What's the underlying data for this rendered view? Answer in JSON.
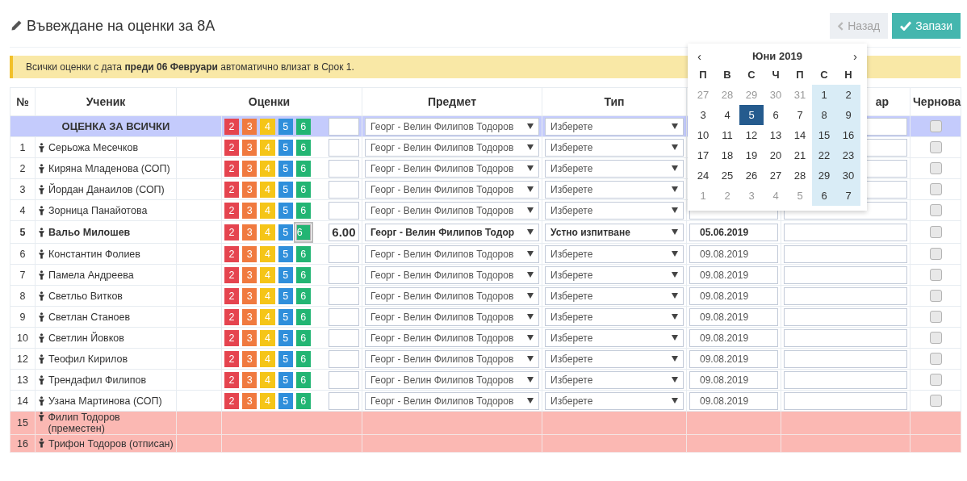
{
  "title": "Въвеждане на оценки за 8А",
  "buttons": [
    {
      "kind": "back",
      "label": "Назад",
      "disabled": true
    },
    {
      "kind": "save",
      "label": "Запази",
      "disabled": false
    }
  ],
  "alert": "Всички оценки с дата **преди 06 Февруари** автоматично влизат в Срок 1.",
  "columns": [
    "№",
    "Ученик",
    "Оценки",
    "Предмет",
    "Тип",
    "ар",
    "Чернова"
  ],
  "rows": [
    {
      "kind": "all",
      "label": "ОЦЕНКА ЗА ВСИЧКИ",
      "grades": [
        {
          "label": "2",
          "color": "#e5444f",
          "selected": false
        },
        {
          "label": "3",
          "color": "#f07a3f",
          "selected": false
        },
        {
          "label": "4",
          "color": "#f5c518",
          "selected": false
        },
        {
          "label": "5",
          "color": "#2f8fdb",
          "selected": false
        },
        {
          "label": "6",
          "color": "#22b573",
          "selected": false
        }
      ],
      "subject": "Георг - Велин Филипов Тодоров",
      "type": "Изберете",
      "checked": false,
      "edited": false
    },
    {
      "kind": "student",
      "number": "1",
      "name": "Серьожа Месечков",
      "grades": [
        {
          "label": "2",
          "color": "#e5444f",
          "selected": false
        },
        {
          "label": "3",
          "color": "#f07a3f",
          "selected": false
        },
        {
          "label": "4",
          "color": "#f5c518",
          "selected": false
        },
        {
          "label": "5",
          "color": "#2f8fdb",
          "selected": false
        },
        {
          "label": "6",
          "color": "#22b573",
          "selected": false
        }
      ],
      "subject": "Георг - Велин Филипов Тодоров",
      "type": "Изберете",
      "checked": false,
      "edited": false
    },
    {
      "kind": "student",
      "number": "2",
      "name": "Киряна Младенова (СОП)",
      "grades": [
        {
          "label": "2",
          "color": "#e5444f",
          "selected": false
        },
        {
          "label": "3",
          "color": "#f07a3f",
          "selected": false
        },
        {
          "label": "4",
          "color": "#f5c518",
          "selected": false
        },
        {
          "label": "5",
          "color": "#2f8fdb",
          "selected": false
        },
        {
          "label": "6",
          "color": "#22b573",
          "selected": false
        }
      ],
      "subject": "Георг - Велин Филипов Тодоров",
      "type": "Изберете",
      "checked": false,
      "edited": false
    },
    {
      "kind": "student",
      "number": "3",
      "name": "Йордан Данаилов (СОП)",
      "grades": [
        {
          "label": "2",
          "color": "#e5444f",
          "selected": false
        },
        {
          "label": "3",
          "color": "#f07a3f",
          "selected": false
        },
        {
          "label": "4",
          "color": "#f5c518",
          "selected": false
        },
        {
          "label": "5",
          "color": "#2f8fdb",
          "selected": false
        },
        {
          "label": "6",
          "color": "#22b573",
          "selected": false
        }
      ],
      "subject": "Георг - Велин Филипов Тодоров",
      "type": "Изберете",
      "checked": false,
      "edited": false
    },
    {
      "kind": "student",
      "number": "4",
      "name": "Зорница Панайотова",
      "grades": [
        {
          "label": "2",
          "color": "#e5444f",
          "selected": false
        },
        {
          "label": "3",
          "color": "#f07a3f",
          "selected": false
        },
        {
          "label": "4",
          "color": "#f5c518",
          "selected": false
        },
        {
          "label": "5",
          "color": "#2f8fdb",
          "selected": false
        },
        {
          "label": "6",
          "color": "#22b573",
          "selected": false
        }
      ],
      "subject": "Георг - Велин Филипов Тодоров",
      "type": "Изберете",
      "checked": false,
      "edited": false
    },
    {
      "kind": "student",
      "number": "5",
      "name": "Вальо Милошев",
      "grades": [
        {
          "label": "2",
          "color": "#e5444f",
          "selected": false
        },
        {
          "label": "3",
          "color": "#f07a3f",
          "selected": false
        },
        {
          "label": "4",
          "color": "#f5c518",
          "selected": false
        },
        {
          "label": "5",
          "color": "#2f8fdb",
          "selected": false
        },
        {
          "label": "6",
          "color": "#22b573",
          "selected": true
        }
      ],
      "value": "6.00",
      "subject": "Георг - Велин Филипов Тодор",
      "type": "Устно изпитване",
      "date": "05.06.2019",
      "checked": false,
      "edited": true
    },
    {
      "kind": "student",
      "number": "6",
      "name": "Константин Фолиев",
      "grades": [
        {
          "label": "2",
          "color": "#e5444f",
          "selected": false
        },
        {
          "label": "3",
          "color": "#f07a3f",
          "selected": false
        },
        {
          "label": "4",
          "color": "#f5c518",
          "selected": false
        },
        {
          "label": "5",
          "color": "#2f8fdb",
          "selected": false
        },
        {
          "label": "6",
          "color": "#22b573",
          "selected": false
        }
      ],
      "subject": "Георг - Велин Филипов Тодоров",
      "type": "Изберете",
      "date": "09.08.2019",
      "checked": false,
      "edited": false
    },
    {
      "kind": "student",
      "number": "7",
      "name": "Памела Андреева",
      "grades": [
        {
          "label": "2",
          "color": "#e5444f",
          "selected": false
        },
        {
          "label": "3",
          "color": "#f07a3f",
          "selected": false
        },
        {
          "label": "4",
          "color": "#f5c518",
          "selected": false
        },
        {
          "label": "5",
          "color": "#2f8fdb",
          "selected": false
        },
        {
          "label": "6",
          "color": "#22b573",
          "selected": false
        }
      ],
      "subject": "Георг - Велин Филипов Тодоров",
      "type": "Изберете",
      "date": "09.08.2019",
      "checked": false,
      "edited": false
    },
    {
      "kind": "student",
      "number": "8",
      "name": "Светльо Витков",
      "grades": [
        {
          "label": "2",
          "color": "#e5444f",
          "selected": false
        },
        {
          "label": "3",
          "color": "#f07a3f",
          "selected": false
        },
        {
          "label": "4",
          "color": "#f5c518",
          "selected": false
        },
        {
          "label": "5",
          "color": "#2f8fdb",
          "selected": false
        },
        {
          "label": "6",
          "color": "#22b573",
          "selected": false
        }
      ],
      "subject": "Георг - Велин Филипов Тодоров",
      "type": "Изберете",
      "date": "09.08.2019",
      "checked": false,
      "edited": false
    },
    {
      "kind": "student",
      "number": "9",
      "name": "Светлан Станоев",
      "grades": [
        {
          "label": "2",
          "color": "#e5444f",
          "selected": false
        },
        {
          "label": "3",
          "color": "#f07a3f",
          "selected": false
        },
        {
          "label": "4",
          "color": "#f5c518",
          "selected": false
        },
        {
          "label": "5",
          "color": "#2f8fdb",
          "selected": false
        },
        {
          "label": "6",
          "color": "#22b573",
          "selected": false
        }
      ],
      "subject": "Георг - Велин Филипов Тодоров",
      "type": "Изберете",
      "date": "09.08.2019",
      "checked": false,
      "edited": false
    },
    {
      "kind": "student",
      "number": "10",
      "name": "Светлин Йовков",
      "grades": [
        {
          "label": "2",
          "color": "#e5444f",
          "selected": false
        },
        {
          "label": "3",
          "color": "#f07a3f",
          "selected": false
        },
        {
          "label": "4",
          "color": "#f5c518",
          "selected": false
        },
        {
          "label": "5",
          "color": "#2f8fdb",
          "selected": false
        },
        {
          "label": "6",
          "color": "#22b573",
          "selected": false
        }
      ],
      "subject": "Георг - Велин Филипов Тодоров",
      "type": "Изберете",
      "date": "09.08.2019",
      "checked": false,
      "edited": false
    },
    {
      "kind": "student",
      "number": "12",
      "name": "Теофил Кирилов",
      "grades": [
        {
          "label": "2",
          "color": "#e5444f",
          "selected": false
        },
        {
          "label": "3",
          "color": "#f07a3f",
          "selected": false
        },
        {
          "label": "4",
          "color": "#f5c518",
          "selected": false
        },
        {
          "label": "5",
          "color": "#2f8fdb",
          "selected": false
        },
        {
          "label": "6",
          "color": "#22b573",
          "selected": false
        }
      ],
      "subject": "Георг - Велин Филипов Тодоров",
      "type": "Изберете",
      "date": "09.08.2019",
      "checked": false,
      "edited": false
    },
    {
      "kind": "student",
      "number": "13",
      "name": "Трендафил Филипов",
      "grades": [
        {
          "label": "2",
          "color": "#e5444f",
          "selected": false
        },
        {
          "label": "3",
          "color": "#f07a3f",
          "selected": false
        },
        {
          "label": "4",
          "color": "#f5c518",
          "selected": false
        },
        {
          "label": "5",
          "color": "#2f8fdb",
          "selected": false
        },
        {
          "label": "6",
          "color": "#22b573",
          "selected": false
        }
      ],
      "subject": "Георг - Велин Филипов Тодоров",
      "type": "Изберете",
      "date": "09.08.2019",
      "checked": false,
      "edited": false
    },
    {
      "kind": "student",
      "number": "14",
      "name": "Узана Мартинова (СОП)",
      "grades": [
        {
          "label": "2",
          "color": "#e5444f",
          "selected": false
        },
        {
          "label": "3",
          "color": "#f07a3f",
          "selected": false
        },
        {
          "label": "4",
          "color": "#f5c518",
          "selected": false
        },
        {
          "label": "5",
          "color": "#2f8fdb",
          "selected": false
        },
        {
          "label": "6",
          "color": "#22b573",
          "selected": false
        }
      ],
      "subject": "Георг - Велин Филипов Тодоров",
      "type": "Изберете",
      "date": "09.08.2019",
      "checked": false,
      "edited": false
    },
    {
      "kind": "inactive",
      "number": "15",
      "name": "Филип Тодоров (преместен)"
    },
    {
      "kind": "inactive",
      "number": "16",
      "name": "Трифон Тодоров (отписан)"
    }
  ],
  "calendar": {
    "prev": "‹",
    "title": "Юни 2019",
    "next": "›",
    "weekdays": [
      "П",
      "В",
      "С",
      "Ч",
      "П",
      "С",
      "Н"
    ],
    "weeks": [
      [
        {
          "label": "27",
          "muted": true,
          "selected": false
        },
        {
          "label": "28",
          "muted": true,
          "selected": false
        },
        {
          "label": "29",
          "muted": true,
          "selected": false
        },
        {
          "label": "30",
          "muted": true,
          "selected": false
        },
        {
          "label": "31",
          "muted": true,
          "selected": false
        },
        {
          "label": "1",
          "muted": false,
          "selected": false
        },
        {
          "label": "2",
          "muted": false,
          "selected": false
        }
      ],
      [
        {
          "label": "3",
          "muted": false,
          "selected": false
        },
        {
          "label": "4",
          "muted": false,
          "selected": false
        },
        {
          "label": "5",
          "muted": false,
          "selected": true
        },
        {
          "label": "6",
          "muted": false,
          "selected": false
        },
        {
          "label": "7",
          "muted": false,
          "selected": false
        },
        {
          "label": "8",
          "muted": false,
          "selected": false
        },
        {
          "label": "9",
          "muted": false,
          "selected": false
        }
      ],
      [
        {
          "label": "10",
          "muted": false,
          "selected": false
        },
        {
          "label": "11",
          "muted": false,
          "selected": false
        },
        {
          "label": "12",
          "muted": false,
          "selected": false
        },
        {
          "label": "13",
          "muted": false,
          "selected": false
        },
        {
          "label": "14",
          "muted": false,
          "selected": false
        },
        {
          "label": "15",
          "muted": false,
          "selected": false
        },
        {
          "label": "16",
          "muted": false,
          "selected": false
        }
      ],
      [
        {
          "label": "17",
          "muted": false,
          "selected": false
        },
        {
          "label": "18",
          "muted": false,
          "selected": false
        },
        {
          "label": "19",
          "muted": false,
          "selected": false
        },
        {
          "label": "20",
          "muted": false,
          "selected": false
        },
        {
          "label": "21",
          "muted": false,
          "selected": false
        },
        {
          "label": "22",
          "muted": false,
          "selected": false
        },
        {
          "label": "23",
          "muted": false,
          "selected": false
        }
      ],
      [
        {
          "label": "24",
          "muted": false,
          "selected": false
        },
        {
          "label": "25",
          "muted": false,
          "selected": false
        },
        {
          "label": "26",
          "muted": false,
          "selected": false
        },
        {
          "label": "27",
          "muted": false,
          "selected": false
        },
        {
          "label": "28",
          "muted": false,
          "selected": false
        },
        {
          "label": "29",
          "muted": false,
          "selected": false
        },
        {
          "label": "30",
          "muted": false,
          "selected": false
        }
      ],
      [
        {
          "label": "1",
          "muted": true,
          "selected": false
        },
        {
          "label": "2",
          "muted": true,
          "selected": false
        },
        {
          "label": "3",
          "muted": true,
          "selected": false
        },
        {
          "label": "4",
          "muted": true,
          "selected": false
        },
        {
          "label": "5",
          "muted": true,
          "selected": false
        },
        {
          "label": "6",
          "muted": false,
          "selected": false
        },
        {
          "label": "7",
          "muted": false,
          "selected": false
        }
      ]
    ]
  }
}
